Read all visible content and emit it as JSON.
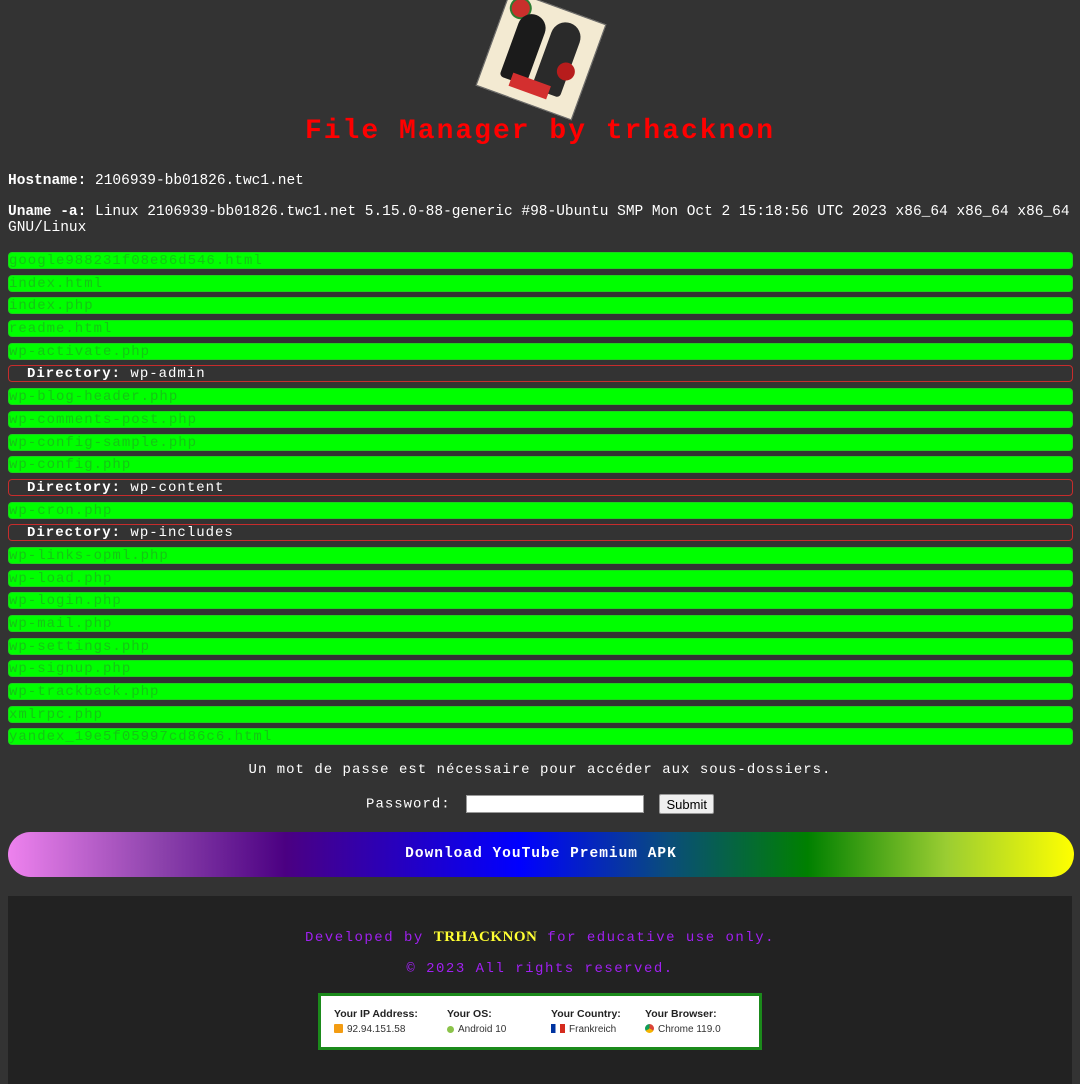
{
  "header": {
    "logo": "trhacknon-logo",
    "title": "File Manager by trhacknon"
  },
  "system": {
    "hostname_label": "Hostname:",
    "hostname": "2106939-bb01826.twc1.net",
    "uname_label": "Uname -a:",
    "uname": "Linux 2106939-bb01826.twc1.net 5.15.0-88-generic #98-Ubuntu SMP Mon Oct 2 15:18:56 UTC 2023 x86_64 x86_64 x86_64 GNU/Linux"
  },
  "entries": [
    {
      "type": "file",
      "name": "google988231f08e86d546.html"
    },
    {
      "type": "file",
      "name": "index.html"
    },
    {
      "type": "file",
      "name": "index.php"
    },
    {
      "type": "file",
      "name": "readme.html"
    },
    {
      "type": "file",
      "name": "wp-activate.php"
    },
    {
      "type": "dir",
      "label": "Directory:",
      "name": "wp-admin"
    },
    {
      "type": "file",
      "name": "wp-blog-header.php"
    },
    {
      "type": "file",
      "name": "wp-comments-post.php"
    },
    {
      "type": "file",
      "name": "wp-config-sample.php"
    },
    {
      "type": "file",
      "name": "wp-config.php"
    },
    {
      "type": "dir",
      "label": "Directory:",
      "name": "wp-content"
    },
    {
      "type": "file",
      "name": "wp-cron.php"
    },
    {
      "type": "dir",
      "label": "Directory:",
      "name": "wp-includes"
    },
    {
      "type": "file",
      "name": "wp-links-opml.php"
    },
    {
      "type": "file",
      "name": "wp-load.php"
    },
    {
      "type": "file",
      "name": "wp-login.php"
    },
    {
      "type": "file",
      "name": "wp-mail.php"
    },
    {
      "type": "file",
      "name": "wp-settings.php"
    },
    {
      "type": "file",
      "name": "wp-signup.php"
    },
    {
      "type": "file",
      "name": "wp-trackback.php"
    },
    {
      "type": "file",
      "name": "xmlrpc.php"
    },
    {
      "type": "file",
      "name": "yandex_19e5f05997cd86c6.html"
    }
  ],
  "auth": {
    "notice": "Un mot de passe est nécessaire pour accéder aux sous-dossiers.",
    "password_label": "Password:",
    "password_value": "",
    "submit_label": "Submit"
  },
  "download": {
    "label": "Download YouTube Premium APK"
  },
  "footer": {
    "dev_prefix": "Developed by ",
    "dev_name": "TRHACKNON",
    "dev_suffix": " for educative use only.",
    "copyright": "© 2023 All rights reserved.",
    "visitor": {
      "ip_label": "Your IP Address:",
      "ip_value": "92.94.151.58",
      "os_label": "Your OS:",
      "os_value": "Android 10",
      "country_label": "Your Country:",
      "country_value": "Frankreich",
      "browser_label": "Your Browser:",
      "browser_value": "Chrome 119.0"
    }
  },
  "colors": {
    "background": "#333333",
    "title": "#ff0000",
    "file_row": "#00ff00",
    "dir_border": "#c72c2c",
    "footer_text": "#a020f0",
    "footer_highlight": "#ffff33"
  }
}
